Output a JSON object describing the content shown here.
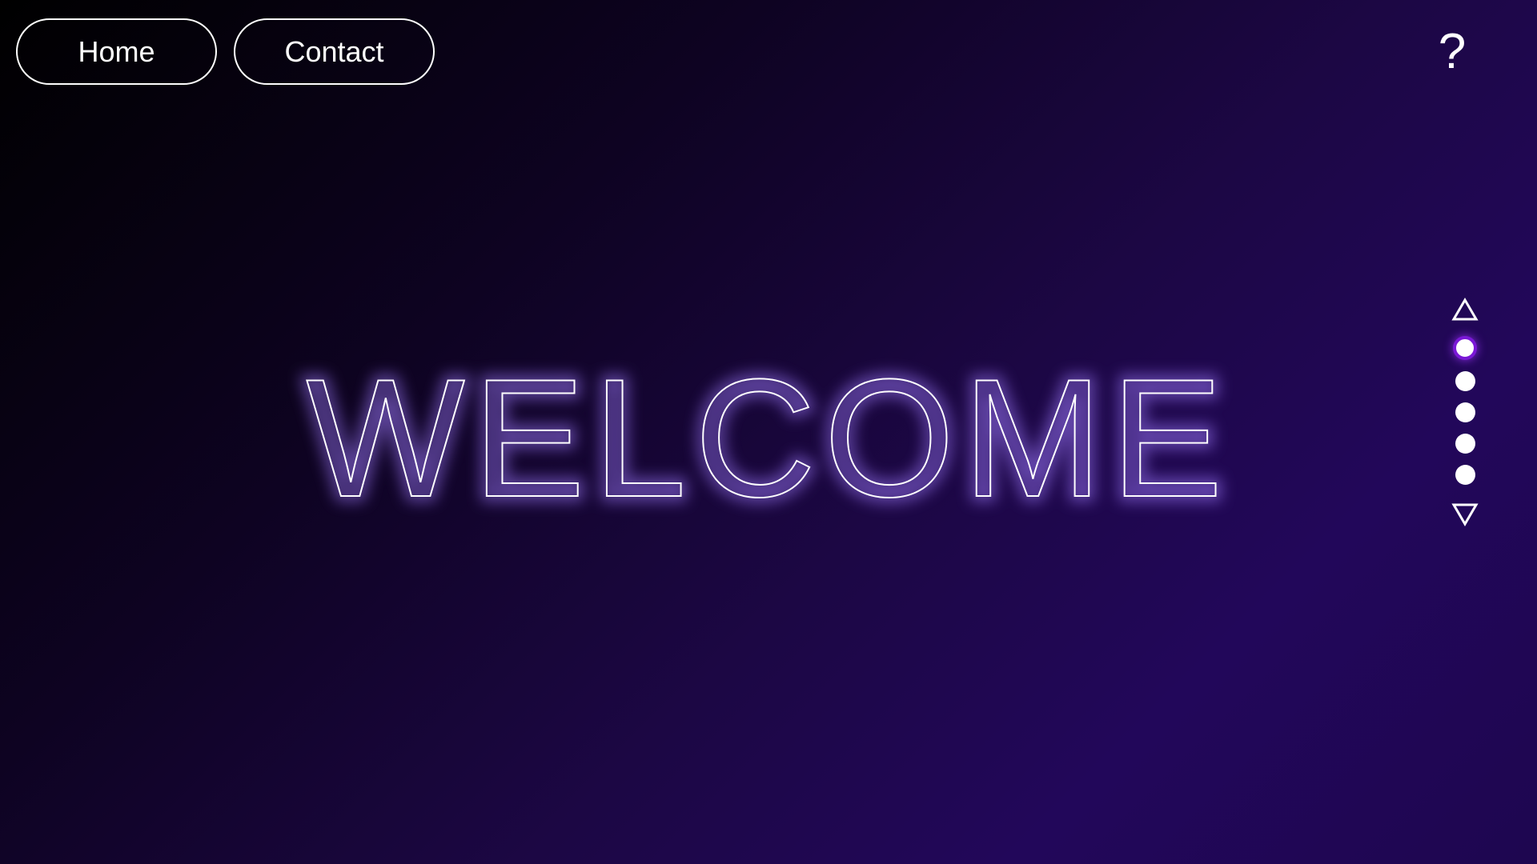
{
  "nav": {
    "home_label": "Home",
    "contact_label": "Contact"
  },
  "help": {
    "label": "?",
    "icon": "help-icon"
  },
  "hero": {
    "title": "WELCOME",
    "glow_color": "#8a6cc8",
    "stroke_color": "#ffffff"
  },
  "page_indicator": {
    "up_icon": "triangle-up-icon",
    "down_icon": "triangle-down-icon",
    "dot_count": 5,
    "active_index": 0,
    "active_color": "#7a18d6"
  },
  "colors": {
    "background_dark": "#000000",
    "background_purple": "#22075a",
    "text": "#ffffff"
  }
}
